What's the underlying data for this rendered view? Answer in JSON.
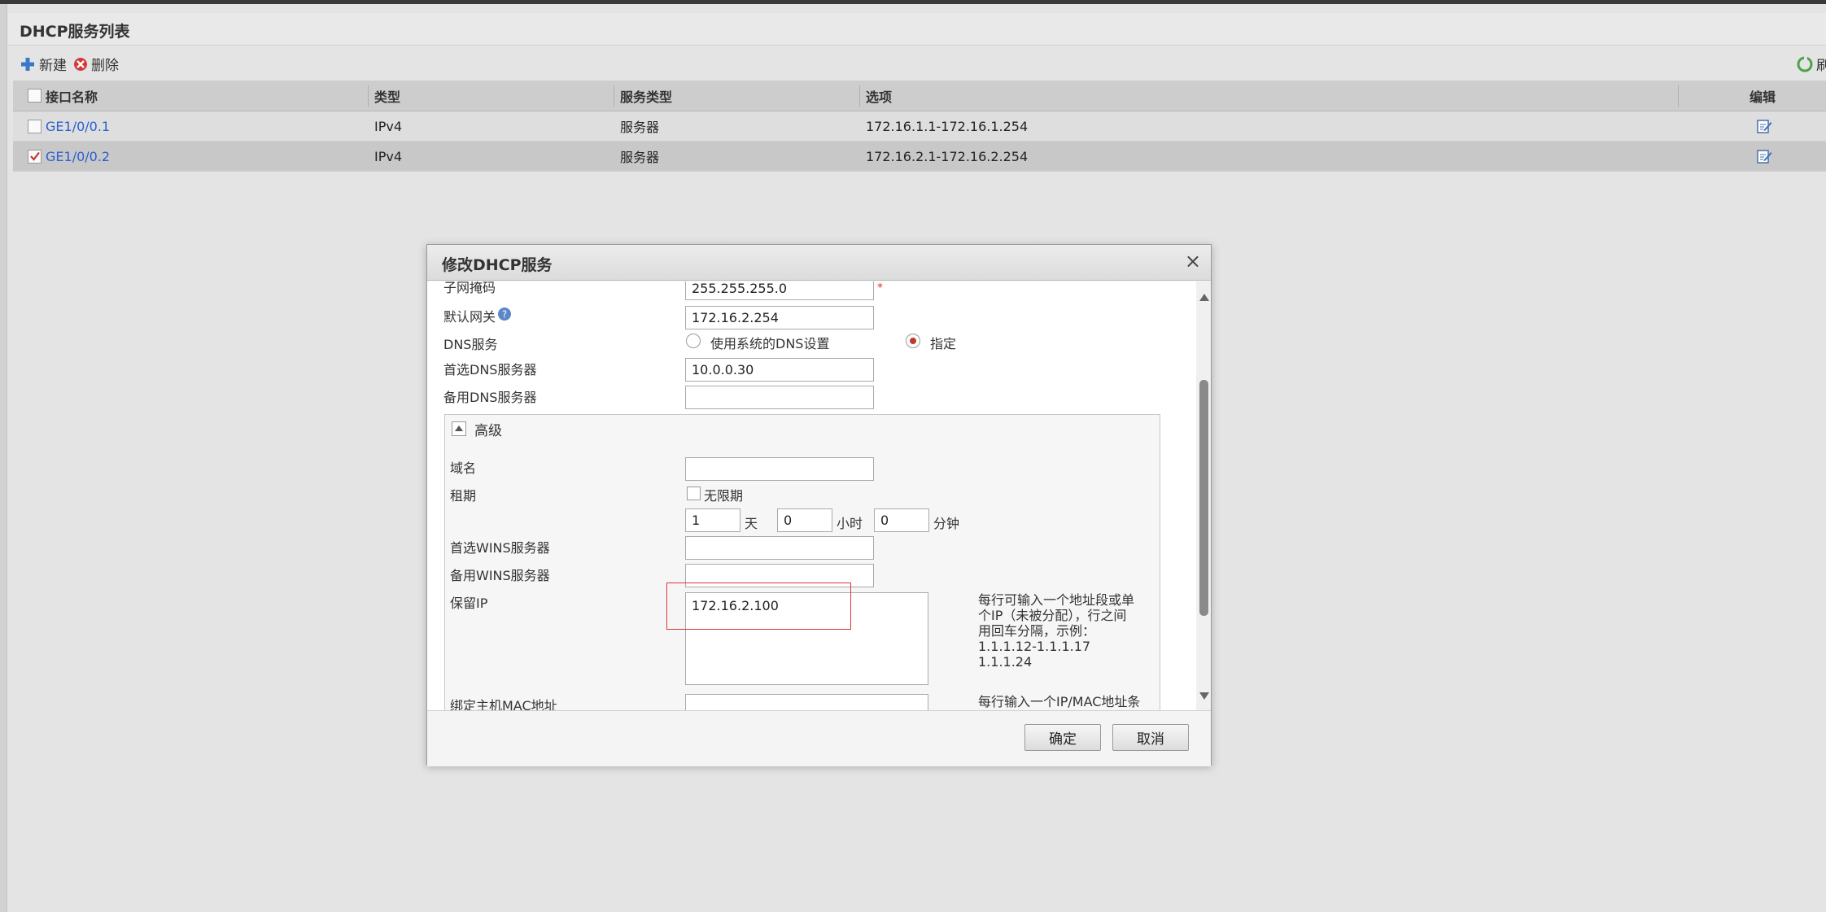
{
  "panel": {
    "title": "DHCP服务列表"
  },
  "toolbar": {
    "new_label": "新建",
    "delete_label": "删除",
    "refresh_label": "刷"
  },
  "grid": {
    "columns": [
      "接口名称",
      "类型",
      "服务类型",
      "选项",
      "编辑"
    ],
    "rows": [
      {
        "name": "GE1/0/0.1",
        "type": "IPv4",
        "service_type": "服务器",
        "options": "172.16.1.1-172.16.1.254",
        "checked": false
      },
      {
        "name": "GE1/0/0.2",
        "type": "IPv4",
        "service_type": "服务器",
        "options": "172.16.2.1-172.16.2.254",
        "checked": true
      }
    ]
  },
  "dialog": {
    "title": "修改DHCP服务",
    "close_symbol": "×",
    "subnet_mask": {
      "label": "子网掩码",
      "value": "255.255.255.0",
      "required_mark": "*"
    },
    "gateway": {
      "label": "默认网关",
      "value": "172.16.2.254"
    },
    "dns_service": {
      "label": "DNS服务",
      "option_system": "使用系统的DNS设置",
      "option_specify": "指定",
      "selected": "指定"
    },
    "primary_dns": {
      "label": "首选DNS服务器",
      "value": "10.0.0.30"
    },
    "secondary_dns": {
      "label": "备用DNS服务器",
      "value": ""
    },
    "advanced": {
      "title": "高级",
      "domain": {
        "label": "域名",
        "value": ""
      },
      "lease": {
        "label": "租期",
        "unlimited_label": "无限期",
        "unlimited": false,
        "days": "1",
        "days_unit": "天",
        "hours": "0",
        "hours_unit": "小时",
        "minutes": "0",
        "minutes_unit": "分钟"
      },
      "primary_wins": {
        "label": "首选WINS服务器",
        "value": ""
      },
      "secondary_wins": {
        "label": "备用WINS服务器",
        "value": ""
      },
      "reserved_ip": {
        "label": "保留IP",
        "value": "172.16.2.100",
        "hint_lines": [
          "每行可输入一个地址段或单",
          "个IP（未被分配），行之间",
          "用回车分隔，示例：",
          "1.1.1.12-1.1.1.17",
          "1.1.1.24"
        ]
      },
      "mac_binding": {
        "label": "绑定主机MAC地址",
        "value": "",
        "hint": "每行输入一个IP/MAC地址条"
      }
    },
    "ok_label": "确定",
    "cancel_label": "取消"
  },
  "colors": {
    "link": "#2b5fd0",
    "highlight_border": "#e0323a",
    "radio_dot": "#c0392b"
  }
}
